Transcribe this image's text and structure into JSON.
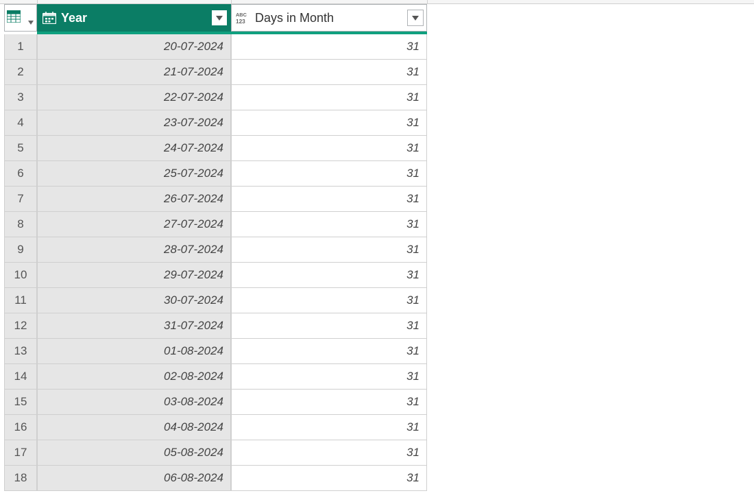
{
  "columns": {
    "year": {
      "label": "Year"
    },
    "days": {
      "label": "Days in Month"
    }
  },
  "rows": [
    {
      "n": 1,
      "year": "20-07-2024",
      "days": "31"
    },
    {
      "n": 2,
      "year": "21-07-2024",
      "days": "31"
    },
    {
      "n": 3,
      "year": "22-07-2024",
      "days": "31"
    },
    {
      "n": 4,
      "year": "23-07-2024",
      "days": "31"
    },
    {
      "n": 5,
      "year": "24-07-2024",
      "days": "31"
    },
    {
      "n": 6,
      "year": "25-07-2024",
      "days": "31"
    },
    {
      "n": 7,
      "year": "26-07-2024",
      "days": "31"
    },
    {
      "n": 8,
      "year": "27-07-2024",
      "days": "31"
    },
    {
      "n": 9,
      "year": "28-07-2024",
      "days": "31"
    },
    {
      "n": 10,
      "year": "29-07-2024",
      "days": "31"
    },
    {
      "n": 11,
      "year": "30-07-2024",
      "days": "31"
    },
    {
      "n": 12,
      "year": "31-07-2024",
      "days": "31"
    },
    {
      "n": 13,
      "year": "01-08-2024",
      "days": "31"
    },
    {
      "n": 14,
      "year": "02-08-2024",
      "days": "31"
    },
    {
      "n": 15,
      "year": "03-08-2024",
      "days": "31"
    },
    {
      "n": 16,
      "year": "04-08-2024",
      "days": "31"
    },
    {
      "n": 17,
      "year": "05-08-2024",
      "days": "31"
    },
    {
      "n": 18,
      "year": "06-08-2024",
      "days": "31"
    }
  ]
}
